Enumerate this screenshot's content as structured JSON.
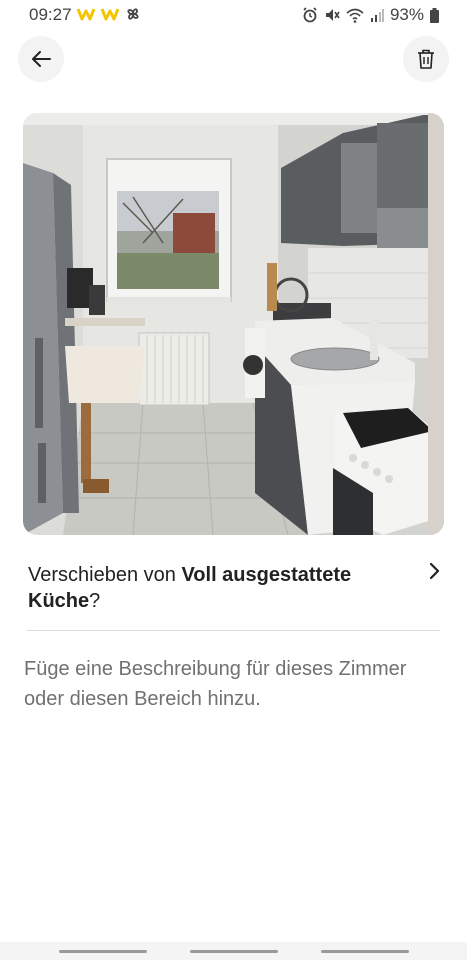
{
  "status_bar": {
    "time": "09:27",
    "battery": "93%",
    "icons_left": [
      "w-app-icon",
      "w-app-icon",
      "pinwheel-icon"
    ],
    "icons_right": [
      "alarm-icon",
      "mute-icon",
      "wifi-icon",
      "signal-icon",
      "battery-icon"
    ]
  },
  "header": {
    "back_icon": "arrow-left-icon",
    "delete_icon": "trash-icon"
  },
  "photo": {
    "subject": "kitchen-photo"
  },
  "move": {
    "prefix": "Verschieben von ",
    "target": "Voll ausgestattete Küche",
    "suffix": "?",
    "icon": "chevron-right-icon"
  },
  "description_placeholder": "Füge eine Beschreibung für dieses Zimmer oder diesen Bereich hinzu.",
  "colors": {
    "button_bg": "#f3f3f3",
    "text_primary": "#222222",
    "text_secondary": "#717171",
    "divider": "#dddddd",
    "accent_yellow": "#f5c400"
  }
}
